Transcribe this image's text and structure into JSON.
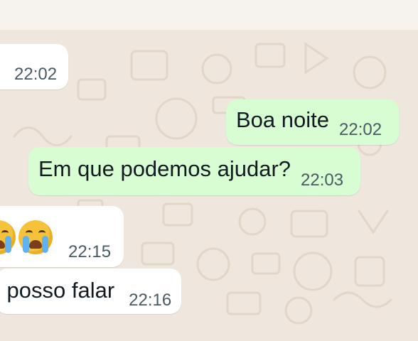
{
  "messages": [
    {
      "direction": "incoming",
      "text": "",
      "time": "22:02"
    },
    {
      "direction": "outgoing",
      "text": "Boa noite",
      "time": "22:02"
    },
    {
      "direction": "outgoing",
      "text": "Em que podemos ajudar?",
      "time": "22:03"
    },
    {
      "direction": "incoming",
      "emoji": [
        "crying-face",
        "crying-face"
      ],
      "time": "22:15"
    },
    {
      "direction": "incoming",
      "text": "l posso falar",
      "time": "22:16"
    }
  ],
  "colors": {
    "wallpaper": "#efe7dd",
    "incoming_bubble": "#ffffff",
    "outgoing_bubble": "#d9fdd3",
    "text": "#111b21",
    "timestamp": "#4a5a63"
  }
}
